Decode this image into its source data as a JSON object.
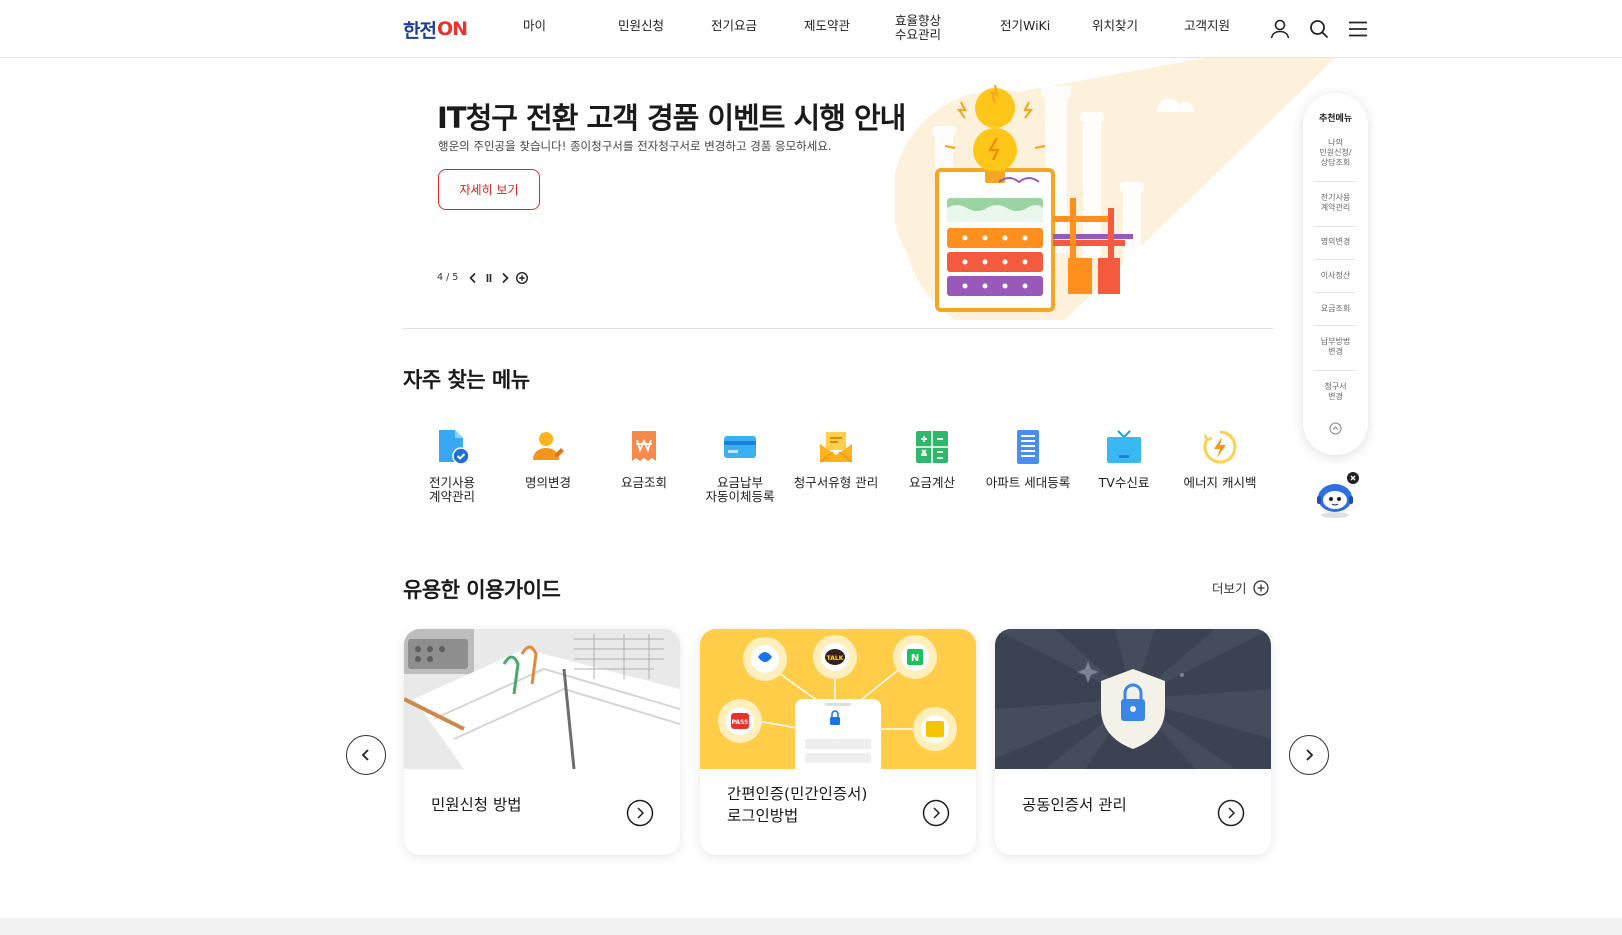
{
  "header": {
    "logo_text": "한전",
    "logo_on": "ON",
    "nav": [
      {
        "label": "마이"
      },
      {
        "label": "민원신청"
      },
      {
        "label": "전기요금"
      },
      {
        "label": "제도약관"
      },
      {
        "label": "효율향상\n수요관리"
      },
      {
        "label": "전기WiKi"
      },
      {
        "label": "위치찾기"
      },
      {
        "label": "고객지원"
      }
    ],
    "icons": [
      "user-icon",
      "search-icon",
      "menu-icon"
    ]
  },
  "hero": {
    "title": "IT청구 전환 고객 경품 이벤트 시행 안내",
    "subtitle": "행운의 주인공을 찾습니다! 종이청구서를 전자청구서로 변경하고 경품 응모하세요.",
    "button_label": "자세히 보기",
    "counter": "4 / 5"
  },
  "quick_menu": {
    "title": "자주 찾는 메뉴",
    "items": [
      {
        "label": "전기사용\n계약관리",
        "icon": "document-check-icon"
      },
      {
        "label": "명의변경",
        "icon": "person-edit-icon"
      },
      {
        "label": "요금조회",
        "icon": "won-receipt-icon"
      },
      {
        "label": "요금납부\n자동이체등록",
        "icon": "card-icon"
      },
      {
        "label": "청구서유형 관리",
        "icon": "envelope-icon"
      },
      {
        "label": "요금계산",
        "icon": "calculator-icon"
      },
      {
        "label": "아파트 세대등록",
        "icon": "apartment-icon"
      },
      {
        "label": "TV수신료",
        "icon": "tv-icon"
      },
      {
        "label": "에너지 캐시백",
        "icon": "energy-cashback-icon"
      }
    ]
  },
  "guide": {
    "title": "유용한 이용가이드",
    "more_label": "더보기",
    "cards": [
      {
        "label": "민원신청 방법"
      },
      {
        "label": "간편인증(민간인증서)\n로그인방법"
      },
      {
        "label": "공동인증서 관리"
      }
    ],
    "card2_badges": [
      "TALK",
      "N",
      "PASS"
    ]
  },
  "recommend": {
    "title": "추천메뉴",
    "items": [
      {
        "label": "나의\n민원신청/\n상담조회"
      },
      {
        "label": "전기사용\n계약관리"
      },
      {
        "label": "명의변경"
      },
      {
        "label": "이사정산"
      },
      {
        "label": "요금조회"
      },
      {
        "label": "납부방법\n변경"
      },
      {
        "label": "청구서\n변경"
      }
    ]
  },
  "colors": {
    "brand_blue": "#1b3f92",
    "brand_red": "#e8322b",
    "accent_red": "#d92020"
  }
}
